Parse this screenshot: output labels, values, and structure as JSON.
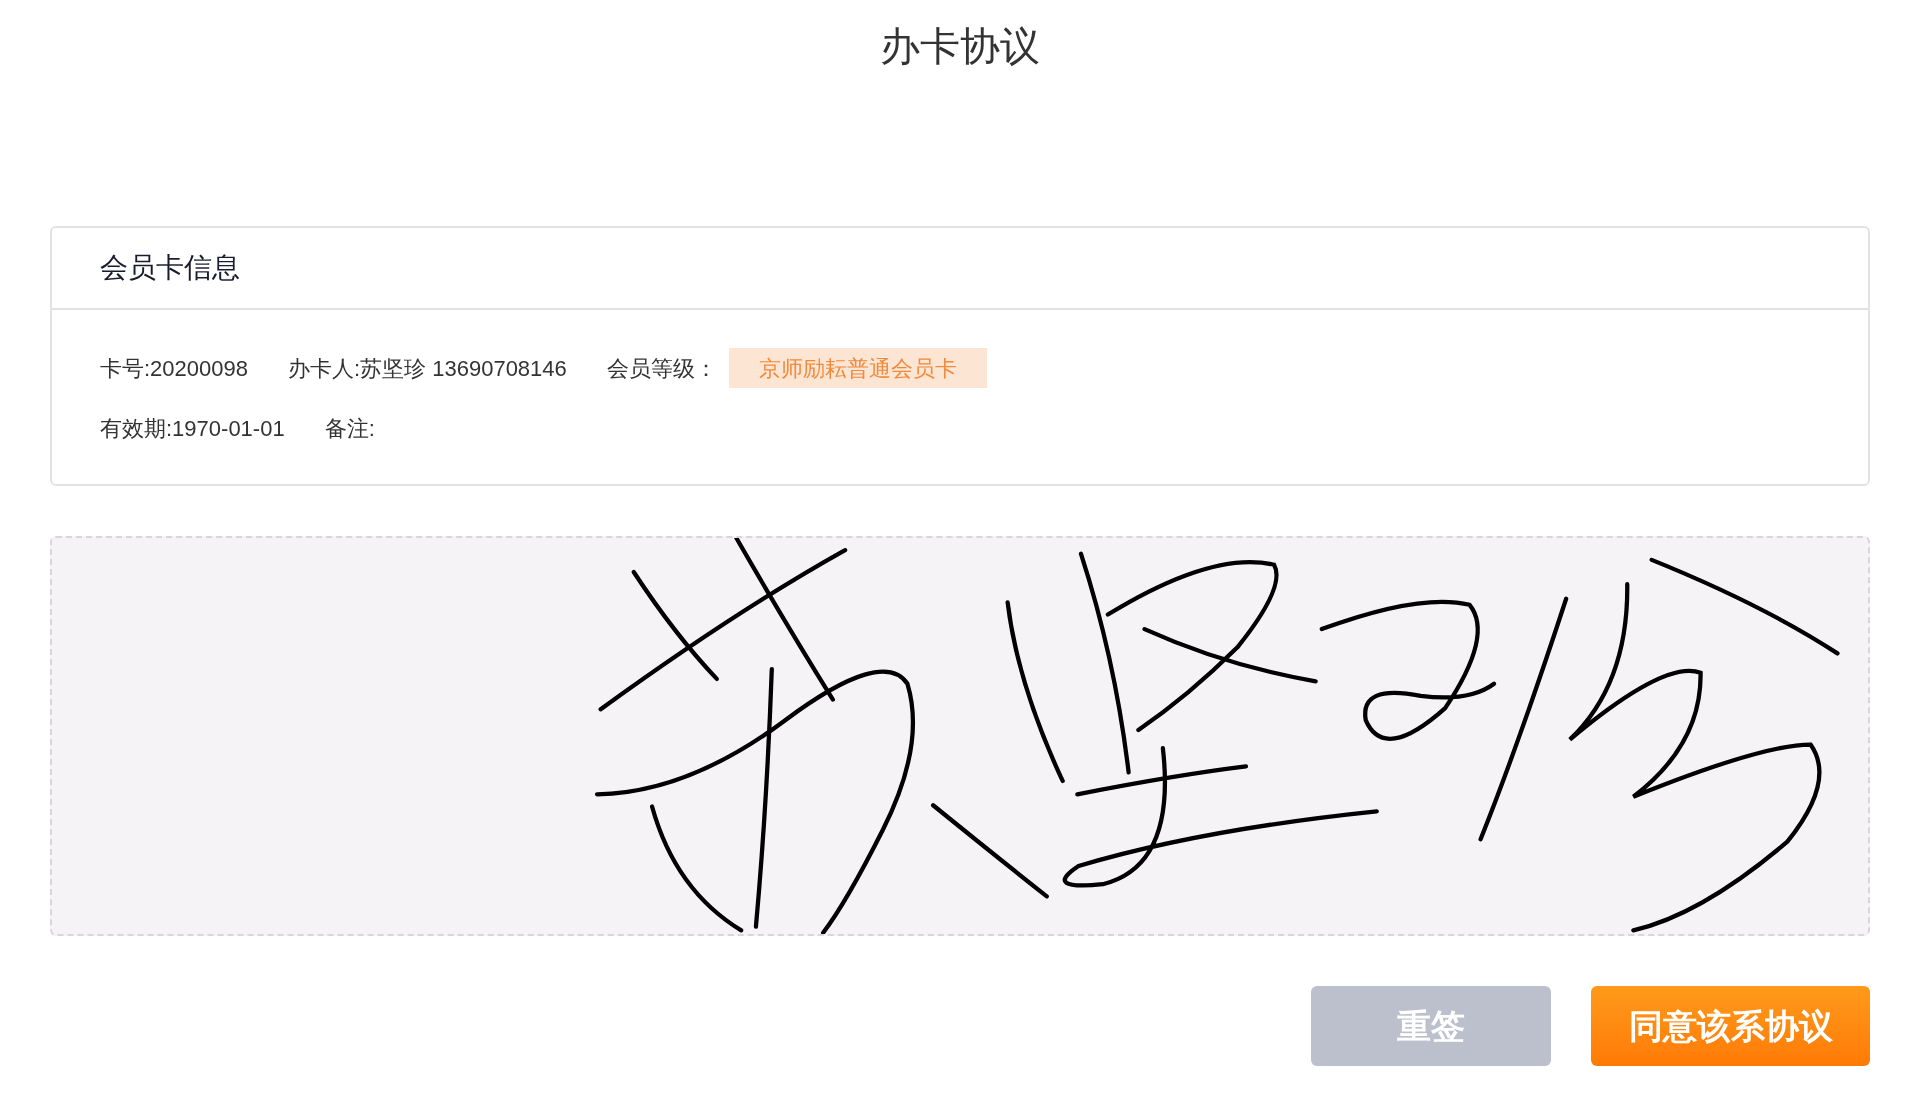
{
  "page_title": "办卡协议",
  "card": {
    "title": "会员卡信息",
    "rows": [
      [
        {
          "text": "卡号:20200098"
        },
        {
          "text": "办卡人:苏坚珍 13690708146"
        },
        {
          "text": "会员等级：",
          "badge": "京师励耘普通会员卡"
        }
      ],
      [
        {
          "text": "有效期:1970-01-01"
        },
        {
          "text": "备注:"
        }
      ]
    ]
  },
  "buttons": [
    {
      "label": "重签",
      "kind": "secondary"
    },
    {
      "label": "同意该系协议",
      "kind": "primary"
    }
  ]
}
